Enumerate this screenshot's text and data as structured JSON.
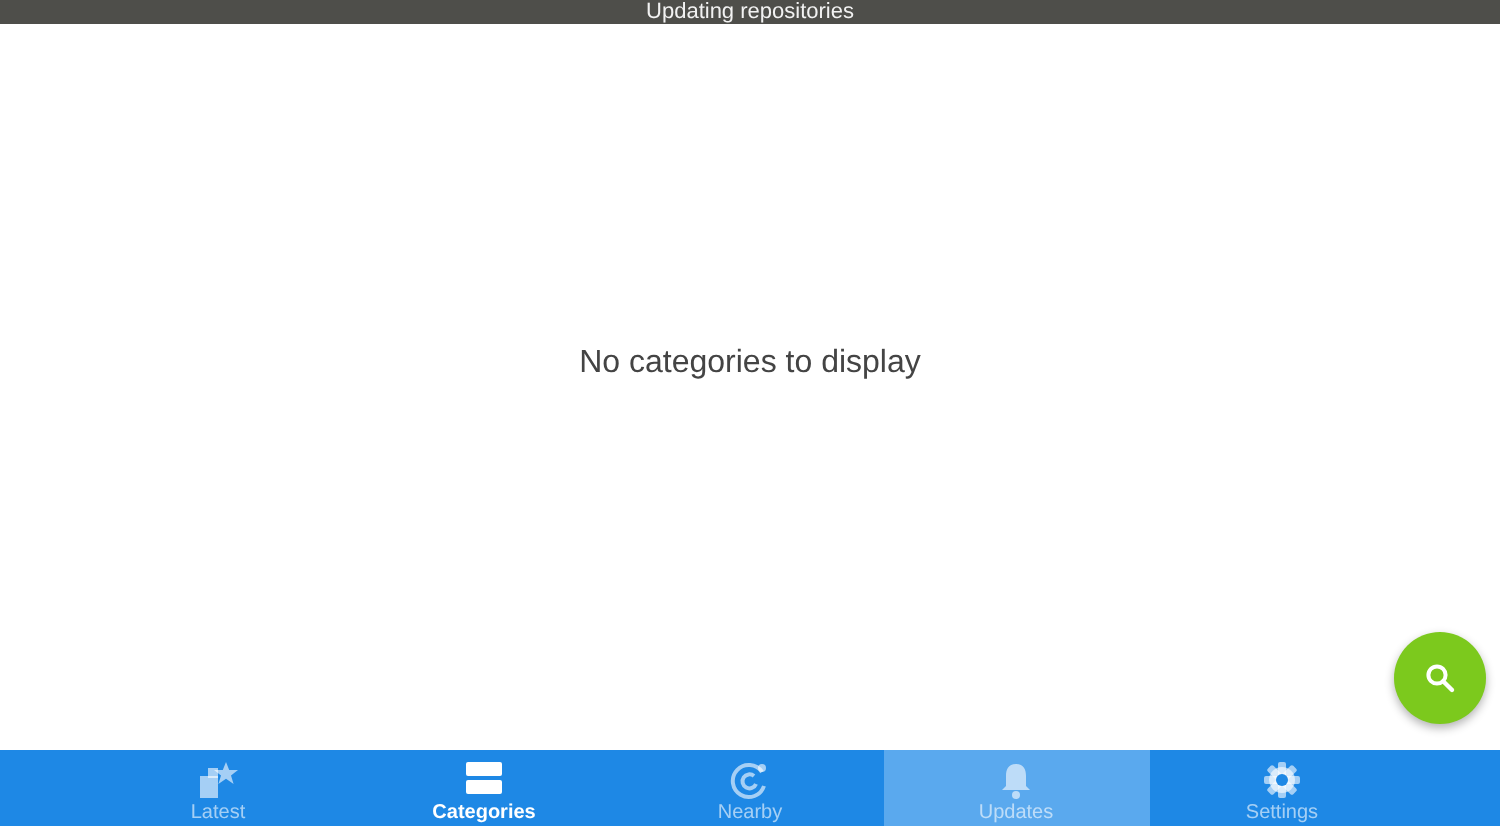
{
  "status_banner": {
    "text": "Updating repositories"
  },
  "empty_message": "No categories to display",
  "tabs": [
    {
      "kind": "latest",
      "label": "Latest",
      "selected": false,
      "pressed": false
    },
    {
      "kind": "categories",
      "label": "Categories",
      "selected": true,
      "pressed": false
    },
    {
      "kind": "nearby",
      "label": "Nearby",
      "selected": false,
      "pressed": false
    },
    {
      "kind": "updates",
      "label": "Updates",
      "selected": false,
      "pressed": true
    },
    {
      "kind": "settings",
      "label": "Settings",
      "selected": false,
      "pressed": false
    }
  ]
}
